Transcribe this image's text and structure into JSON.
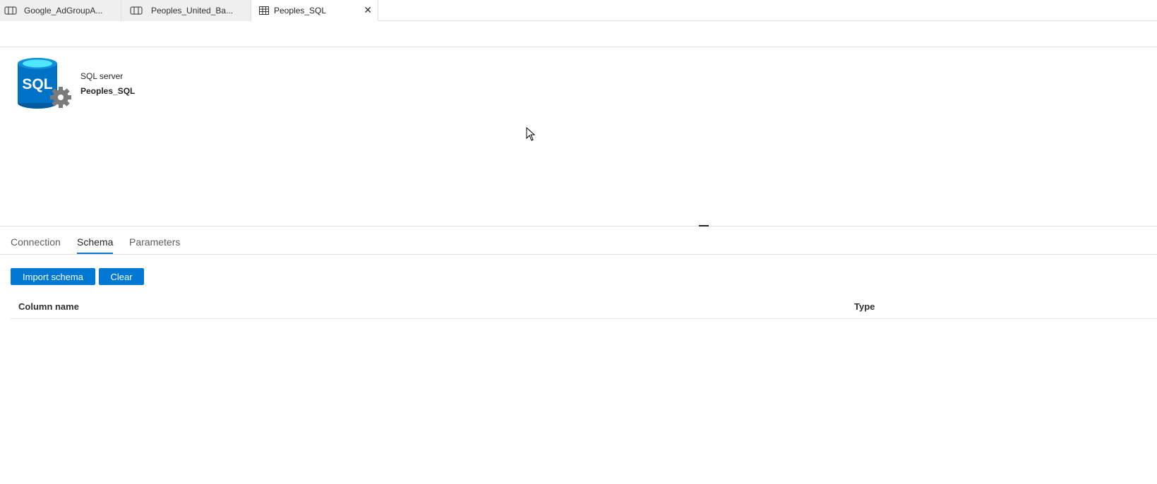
{
  "tabs": [
    {
      "label": "Google_AdGroupA...",
      "icon": "dataset-icon",
      "active": false
    },
    {
      "label": "Peoples_United_Ba...",
      "icon": "dataset-icon",
      "active": false
    },
    {
      "label": "Peoples_SQL",
      "icon": "table-icon",
      "active": true,
      "close": "✕"
    }
  ],
  "dataset": {
    "type_label": "SQL server",
    "name": "Peoples_SQL",
    "logo_text": "SQL",
    "logo_icon": "sql-server-icon"
  },
  "subtabs": [
    {
      "label": "Connection",
      "active": false
    },
    {
      "label": "Schema",
      "active": true
    },
    {
      "label": "Parameters",
      "active": false
    }
  ],
  "schema": {
    "import_button": "Import schema",
    "clear_button": "Clear",
    "columns": {
      "name": "Column name",
      "type": "Type"
    },
    "rows": []
  },
  "colors": {
    "accent": "#0078d4",
    "logo_blue": "#0072c6",
    "logo_cyan": "#50e6ff",
    "gear_gray": "#7a7a7a"
  }
}
